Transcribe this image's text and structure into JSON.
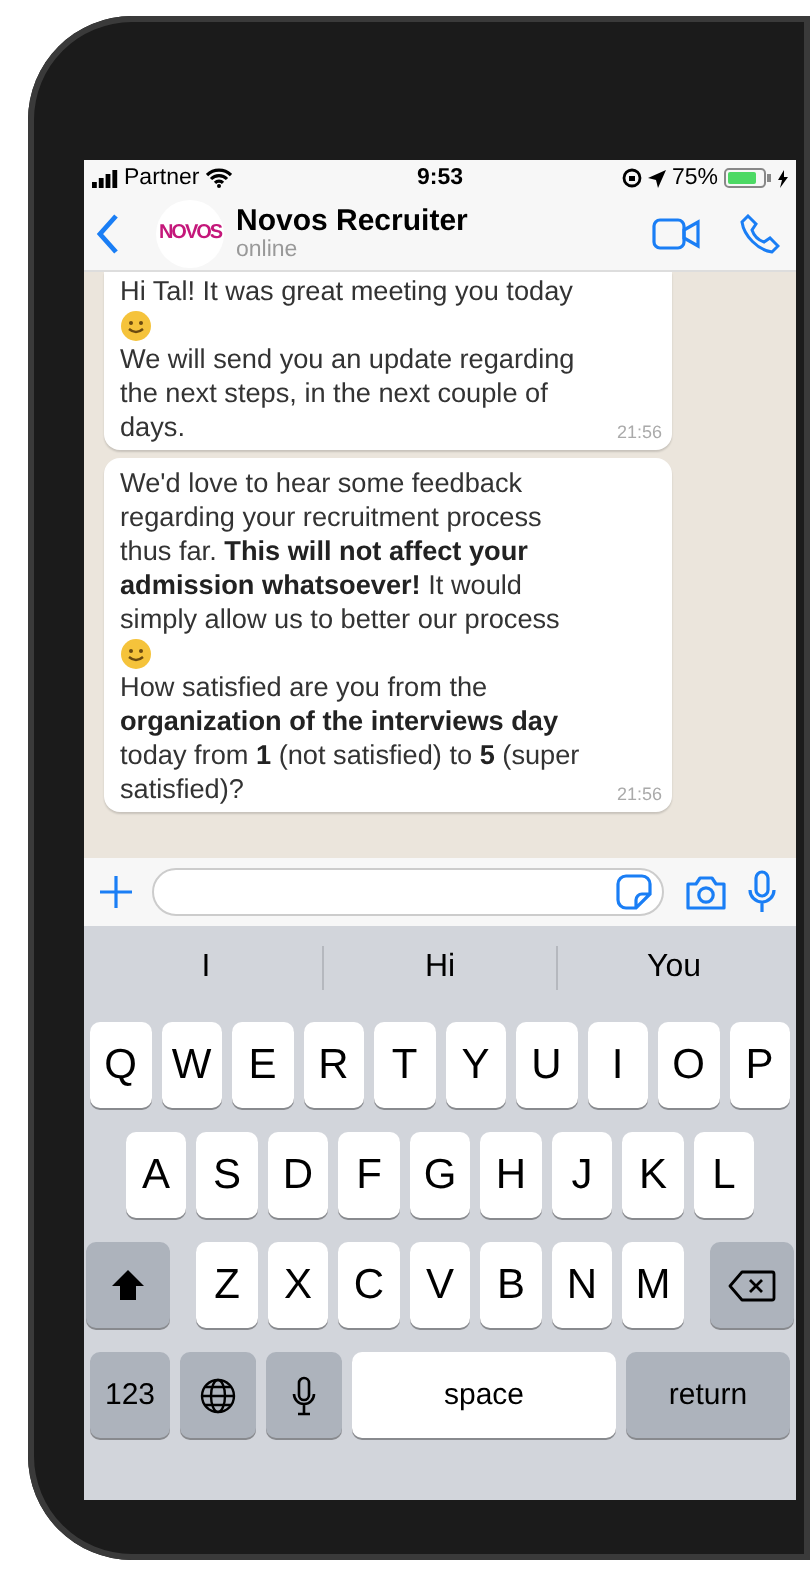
{
  "status_bar": {
    "carrier": "Partner",
    "time": "9:53",
    "battery": "75%"
  },
  "header": {
    "logo_text": "NOVOS",
    "name": "Novos Recruiter",
    "status": "online"
  },
  "messages": [
    {
      "parts": [
        {
          "kind": "text",
          "text": "Hi Tal! It was great meeting you today"
        },
        {
          "kind": "emoji"
        },
        {
          "kind": "text",
          "text": "We will send you an update regarding the next steps, in the next couple of days."
        }
      ],
      "time": "21:56"
    },
    {
      "parts": [
        {
          "kind": "text",
          "text": "We'd love to hear some feedback regarding your recruitment process thus far. **This will not affect your admission whatsoever!** It would simply allow us to better our process"
        },
        {
          "kind": "emoji"
        },
        {
          "kind": "text",
          "text": "How satisfied are you from the **organization of the interviews day** today from **1** (not satisfied) to **5** (super satisfied)?"
        }
      ],
      "time": "21:56"
    }
  ],
  "keyboard": {
    "suggestions": [
      "I",
      "Hi",
      "You"
    ],
    "key_rows": [
      {
        "keys": [
          {
            "kind": "letter",
            "label": "Q"
          },
          {
            "kind": "letter",
            "label": "W"
          },
          {
            "kind": "letter",
            "label": "E"
          },
          {
            "kind": "letter",
            "label": "R"
          },
          {
            "kind": "letter",
            "label": "T"
          },
          {
            "kind": "letter",
            "label": "Y"
          },
          {
            "kind": "letter",
            "label": "U"
          },
          {
            "kind": "letter",
            "label": "I"
          },
          {
            "kind": "letter",
            "label": "O"
          },
          {
            "kind": "letter",
            "label": "P"
          }
        ]
      },
      {
        "keys": [
          {
            "kind": "letter",
            "label": "A"
          },
          {
            "kind": "letter",
            "label": "S"
          },
          {
            "kind": "letter",
            "label": "D"
          },
          {
            "kind": "letter",
            "label": "F"
          },
          {
            "kind": "letter",
            "label": "G"
          },
          {
            "kind": "letter",
            "label": "H"
          },
          {
            "kind": "letter",
            "label": "J"
          },
          {
            "kind": "letter",
            "label": "K"
          },
          {
            "kind": "letter",
            "label": "L"
          }
        ]
      },
      {
        "keys": [
          {
            "kind": "shift"
          },
          {
            "kind": "letter",
            "label": "Z"
          },
          {
            "kind": "letter",
            "label": "X"
          },
          {
            "kind": "letter",
            "label": "C"
          },
          {
            "kind": "letter",
            "label": "V"
          },
          {
            "kind": "letter",
            "label": "B"
          },
          {
            "kind": "letter",
            "label": "N"
          },
          {
            "kind": "letter",
            "label": "M"
          },
          {
            "kind": "backspace"
          }
        ]
      },
      {
        "keys": [
          {
            "kind": "numbers",
            "label": "123"
          },
          {
            "kind": "globe"
          },
          {
            "kind": "mic"
          },
          {
            "kind": "space",
            "label": "space"
          },
          {
            "kind": "return",
            "label": "return"
          }
        ]
      }
    ]
  }
}
